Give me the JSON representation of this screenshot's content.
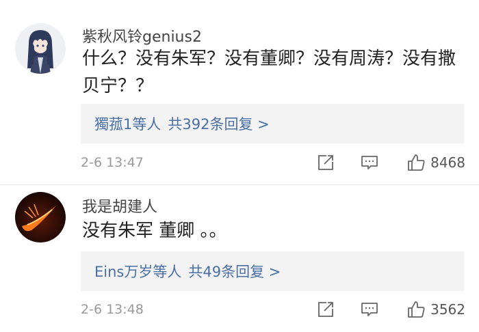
{
  "comments": [
    {
      "username": "紫秋风铃genius2",
      "content": "什么？没有朱军？没有董卿？没有周涛？没有撒贝宁？？",
      "replies": {
        "user": "獨菰1等人",
        "count_text": "共392条回复 >"
      },
      "time": "2-6 13:47",
      "likes": "8468",
      "avatar": "anime-girl-avatar"
    },
    {
      "username": "我是胡建人",
      "content": "没有朱军 董卿 。。",
      "replies": {
        "user": "Eins万岁等人",
        "count_text": "共49条回复 >"
      },
      "time": "2-6 13:48",
      "likes": "3562",
      "avatar": "orange-swoosh-avatar"
    }
  ],
  "colors": {
    "link": "#4a6fa5",
    "reply_bg": "#f3f3f3",
    "meta": "#999999",
    "icon": "#666666"
  },
  "icons": {
    "share": "share-icon",
    "comment": "comment-icon",
    "like": "thumbs-up-icon"
  }
}
